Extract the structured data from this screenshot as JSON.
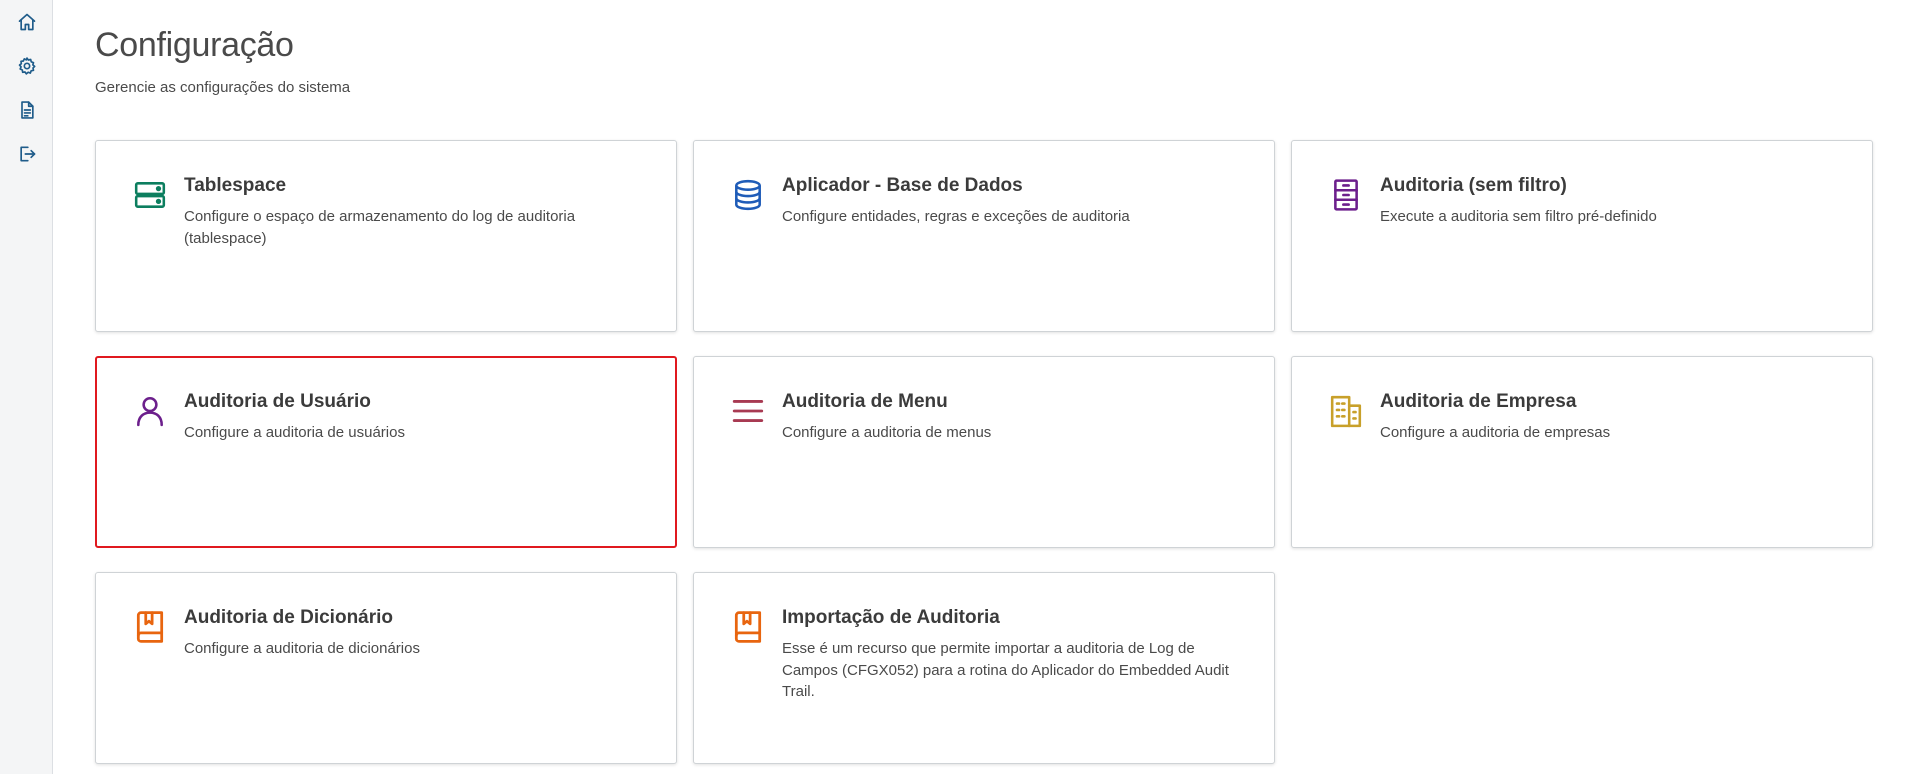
{
  "sidebar": {
    "items": [
      {
        "icon": "home-icon"
      },
      {
        "icon": "gear-icon"
      },
      {
        "icon": "document-icon"
      },
      {
        "icon": "logout-icon"
      }
    ]
  },
  "header": {
    "title": "Configuração",
    "subtitle": "Gerencie as configurações do sistema"
  },
  "cards": [
    {
      "title": "Tablespace",
      "description": "Configure o espaço de armazenamento do log de auditoria (tablespace)",
      "icon": "server-icon",
      "color": "#0c7e5f"
    },
    {
      "title": "Aplicador - Base de Dados",
      "description": "Configure entidades, regras e exceções de auditoria",
      "icon": "database-icon",
      "color": "#1f5cb8"
    },
    {
      "title": "Auditoria (sem filtro)",
      "description": "Execute a auditoria sem filtro pré-definido",
      "icon": "filing-cabinet-icon",
      "color": "#6c1f8c"
    },
    {
      "title": "Auditoria de Usuário",
      "description": "Configure a auditoria de usuários",
      "icon": "user-icon",
      "color": "#6c1f8c",
      "selected": true
    },
    {
      "title": "Auditoria de Menu",
      "description": "Configure a auditoria de menus",
      "icon": "menu-icon",
      "color": "#a83a52"
    },
    {
      "title": "Auditoria de Empresa",
      "description": "Configure a auditoria de empresas",
      "icon": "building-icon",
      "color": "#c8a02a"
    },
    {
      "title": "Auditoria de Dicionário",
      "description": "Configure a auditoria de dicionários",
      "icon": "book-icon",
      "color": "#e8650f"
    },
    {
      "title": "Importação de Auditoria",
      "description": "Esse é um recurso que permite importar a auditoria de Log de Campos (CFGX052) para a rotina do Aplicador do Embedded Audit Trail.",
      "icon": "book-icon",
      "color": "#e8650f"
    }
  ],
  "colors": {
    "sidebar_icon": "#1f5c8a",
    "selected_border": "#e0191f"
  }
}
